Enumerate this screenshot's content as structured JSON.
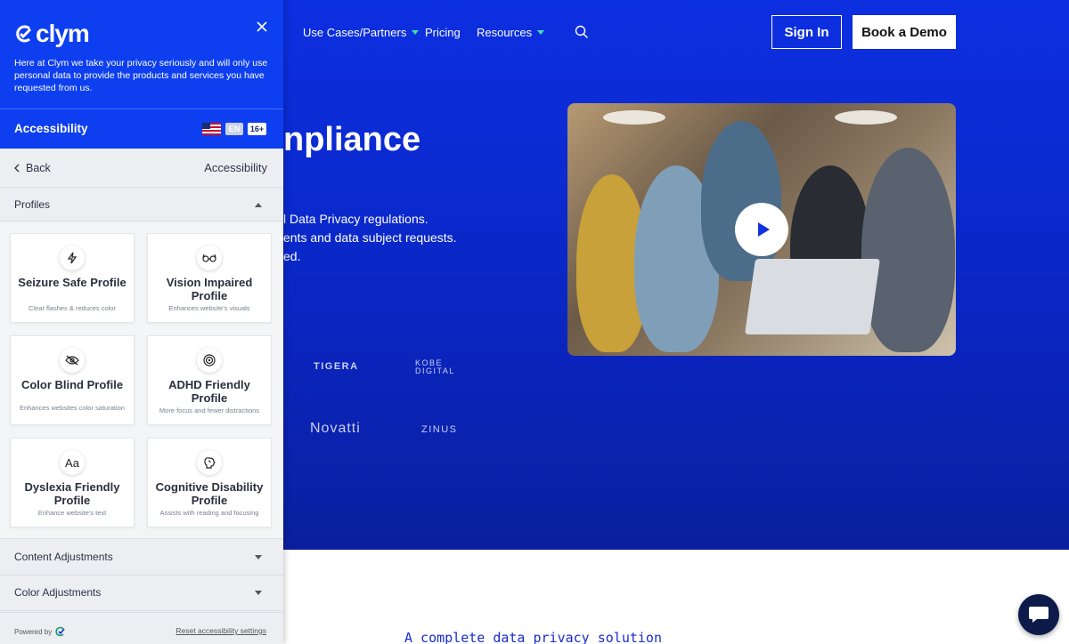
{
  "site": {
    "nav": [
      {
        "label": "Use Cases/Partners",
        "has_caret": true
      },
      {
        "label": "Pricing",
        "has_caret": false
      },
      {
        "label": "Resources",
        "has_caret": true
      }
    ],
    "sign_in_label": "Sign In",
    "book_demo_label": "Book a Demo",
    "hero_title_visible": "npliance",
    "hero_lines": [
      "l Data Privacy regulations.",
      "ents and data subject requests.",
      "ed."
    ],
    "partner_logos": [
      "TIGERA",
      "KOBE DIGITAL",
      "Novatti",
      "ZINUS"
    ],
    "section_heading": "A complete data privacy solution",
    "colors": {
      "hero": "#0c2fe0",
      "accent_caret": "#3fe0b0"
    }
  },
  "panel": {
    "brand": "clym",
    "intro": "Here at Clym we take your privacy seriously and will only use personal data to provide the products and services you have requested from us.",
    "accessibility_title": "Accessibility",
    "language_badge": "EN",
    "age_badge": "16+",
    "back_label": "Back",
    "breadcrumb_title": "Accessibility",
    "profiles_label": "Profiles",
    "profiles": [
      {
        "title": "Seizure Safe Profile",
        "desc": "Clear flashes & reduces color",
        "icon": "bolt-icon"
      },
      {
        "title": "Vision Impaired Profile",
        "desc": "Enhances website's visuals",
        "icon": "glasses-icon"
      },
      {
        "title": "Color Blind Profile",
        "desc": "Enhances websites color saturation",
        "icon": "eye-slash-icon"
      },
      {
        "title": "ADHD Friendly Profile",
        "desc": "More focus and fewer distractions",
        "icon": "target-icon"
      },
      {
        "title": "Dyslexia Friendly Profile",
        "desc": "Enhance website's text",
        "icon": "font-icon",
        "icon_glyph": "Aa"
      },
      {
        "title": "Cognitive Disability Profile",
        "desc": "Assists with reading and focusing",
        "icon": "brain-icon"
      }
    ],
    "content_adjustments_label": "Content Adjustments",
    "color_adjustments_label": "Color Adjustments",
    "powered_by_label": "Powered by",
    "reset_label": "Reset accessibility settings",
    "colors": {
      "panel_header": "#0d3ff0",
      "panel_bg": "#eceef2"
    }
  }
}
